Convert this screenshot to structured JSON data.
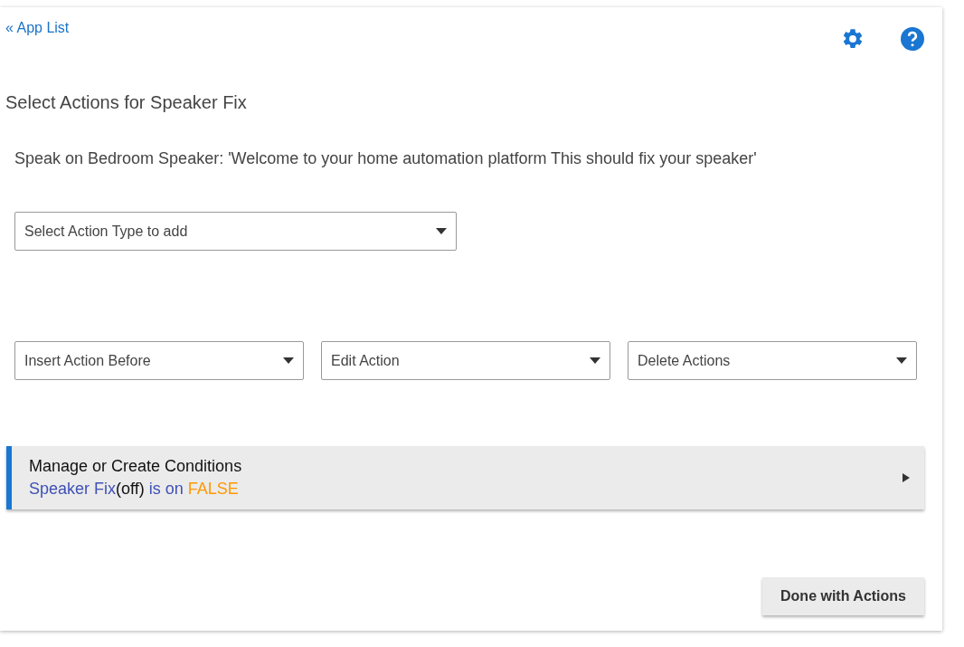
{
  "back_link": "« App List",
  "title": "Select Actions for Speaker Fix",
  "actions": [
    "Speak on Bedroom Speaker: 'Welcome to your home automation platform This should fix your speaker'"
  ],
  "action_type_select": {
    "placeholder": "Select Action Type to add"
  },
  "action_selects": [
    {
      "placeholder": "Insert Action Before"
    },
    {
      "placeholder": "Edit Action"
    },
    {
      "placeholder": "Delete Actions"
    }
  ],
  "conditions_panel": {
    "title": "Manage or Create Conditions",
    "expanded": false,
    "condition": [
      {
        "kind": "device",
        "text": "Speaker Fix"
      },
      {
        "kind": "state",
        "text": "(off)"
      },
      {
        "kind": "device",
        "text": " is on "
      },
      {
        "kind": "value",
        "text": "FALSE"
      }
    ]
  },
  "done_button": "Done with Actions"
}
